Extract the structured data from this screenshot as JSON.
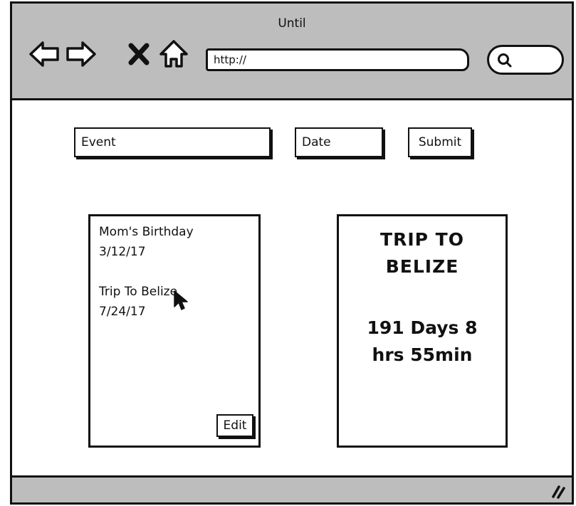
{
  "window": {
    "title": "Until"
  },
  "toolbar": {
    "icons": [
      "back-arrow-icon",
      "forward-arrow-icon",
      "close-icon",
      "home-icon"
    ],
    "url_value": "http://",
    "search_icon": "magnifier-icon"
  },
  "form": {
    "event_placeholder": "Event",
    "date_placeholder": "Date",
    "submit_label": "Submit"
  },
  "events": [
    {
      "name": "Mom's Birthday",
      "date": "3/12/17"
    },
    {
      "name": "Trip To Belize",
      "date": "7/24/17"
    }
  ],
  "list_panel": {
    "edit_label": "Edit"
  },
  "detail": {
    "title_line1": "TRIP TO",
    "title_line2": "BELIZE",
    "countdown_line1": "191 Days 8",
    "countdown_line2": "hrs 55min"
  },
  "colors": {
    "chrome": "#bdbdbd",
    "ink": "#111111",
    "background": "#ffffff"
  }
}
